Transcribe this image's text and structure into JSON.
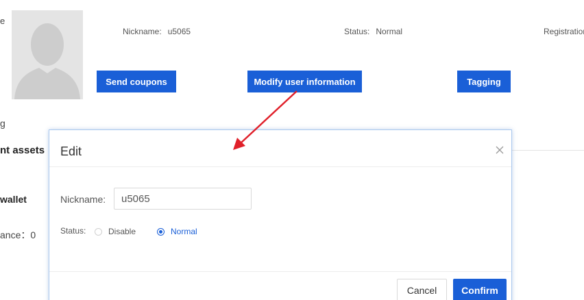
{
  "background": {
    "left_texts": {
      "t1": "e",
      "t2": "g",
      "t3": "nt assets",
      "t4": "wallet",
      "t5": "ance：0"
    },
    "nickname_label": "Nickname:",
    "nickname_value": "u5065",
    "status_label": "Status:",
    "status_value": "Normal",
    "registration_label": "Registration",
    "buttons": {
      "send_coupons": "Send coupons",
      "modify_user": "Modify user information",
      "tagging": "Tagging"
    }
  },
  "modal": {
    "title": "Edit",
    "nickname_label": "Nickname:",
    "nickname_value": "u5065",
    "status_label": "Status:",
    "status_options": [
      {
        "label": "Disable",
        "selected": false
      },
      {
        "label": "Normal",
        "selected": true
      }
    ],
    "cancel_label": "Cancel",
    "confirm_label": "Confirm"
  },
  "colors": {
    "primary": "#1a5fd7",
    "arrow": "#e0202a"
  }
}
